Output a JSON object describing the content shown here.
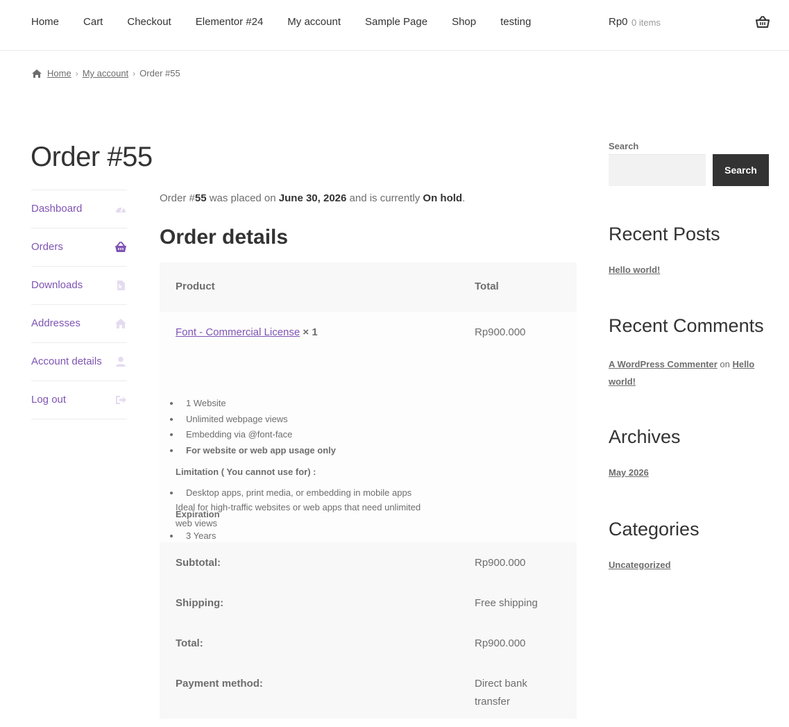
{
  "header": {
    "nav": [
      "Home",
      "Cart",
      "Checkout",
      "Elementor #24",
      "My account",
      "Sample Page",
      "Shop",
      "testing"
    ],
    "cart_amount": "Rp0",
    "cart_count": "0 items"
  },
  "breadcrumb": {
    "home": "Home",
    "my_account": "My account",
    "current": "Order #55"
  },
  "page_title": "Order #55",
  "account_nav": [
    {
      "label": "Dashboard",
      "icon": "dashboard-icon"
    },
    {
      "label": "Orders",
      "icon": "basket-icon"
    },
    {
      "label": "Downloads",
      "icon": "file-icon"
    },
    {
      "label": "Addresses",
      "icon": "home-icon"
    },
    {
      "label": "Account details",
      "icon": "user-icon"
    },
    {
      "label": "Log out",
      "icon": "logout-icon"
    }
  ],
  "order_note": {
    "prefix": "Order #",
    "number": "55",
    "mid": " was placed on ",
    "date": "June 30, 2026",
    "mid2": " and is currently ",
    "status": "On hold",
    "end": "."
  },
  "order_details": {
    "heading": "Order details",
    "col_product": "Product",
    "col_total": "Total",
    "item": {
      "name": "Font - Commercial License",
      "qty": "× 1",
      "total": "Rp900.000",
      "features": [
        "1 Website",
        "Unlimited webpage views",
        "Embedding via @font-face",
        "For website or web app usage only"
      ],
      "limitation_label": "Limitation ( You cannot use for) :",
      "limitation": "Desktop apps, print media, or embedding in mobile apps",
      "expiration_label": "Expiration",
      "expiration": "3 Years",
      "description_line1": "Ideal for high-traffic websites or web apps that need unlimited",
      "description_line2": "web views"
    },
    "subtotal_label": "Subtotal:",
    "subtotal": "Rp900.000",
    "shipping_label": "Shipping:",
    "shipping": "Free shipping",
    "total_label": "Total:",
    "total": "Rp900.000",
    "payment_label": "Payment method:",
    "payment_line1": "Direct bank",
    "payment_line2": "transfer"
  },
  "sidebar": {
    "search_label": "Search",
    "search_placeholder": "",
    "search_button": "Search",
    "recent_posts_title": "Recent Posts",
    "recent_posts": [
      "Hello world!"
    ],
    "recent_comments_title": "Recent Comments",
    "comment_author": "A WordPress Commenter",
    "comment_on": " on ",
    "comment_post": "Hello world!",
    "archives_title": "Archives",
    "archives": [
      "May 2026"
    ],
    "categories_title": "Categories",
    "categories": [
      "Uncategorized"
    ]
  },
  "colors": {
    "accent": "#7f54b3",
    "text": "#6d6d6d",
    "heading": "#333333",
    "table_bg": "#f8f8f8"
  }
}
